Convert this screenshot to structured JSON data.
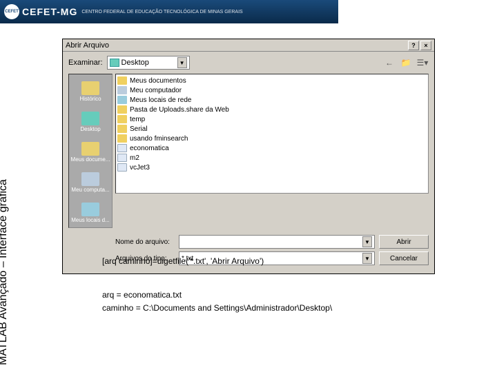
{
  "header": {
    "org": "CEFET-MG",
    "sub": "CENTRO FEDERAL DE EDUCAÇÃO TECNOLÓGICA DE MINAS GERAIS"
  },
  "sidebar_label": "MATLAB  Avançado – Interface gráfica",
  "dialog": {
    "title": "Abrir Arquivo",
    "help": "?",
    "close": "×",
    "lookin_label": "Examinar:",
    "lookin_value": "Desktop",
    "back_icon": "←",
    "up_icon": "📁",
    "view_icon": "☰▾",
    "places": [
      {
        "label": "Histórico"
      },
      {
        "label": "Desktop"
      },
      {
        "label": "Meus docume..."
      },
      {
        "label": "Meu computa..."
      },
      {
        "label": "Meus locais d..."
      }
    ],
    "files": [
      {
        "icon": "folder",
        "name": "Meus documentos"
      },
      {
        "icon": "pc",
        "name": "Meu computador"
      },
      {
        "icon": "net",
        "name": "Meus locais de rede"
      },
      {
        "icon": "folder",
        "name": "Pasta de Uploads.share da Web"
      },
      {
        "icon": "folder",
        "name": "temp"
      },
      {
        "icon": "folder",
        "name": "Serial"
      },
      {
        "icon": "folder",
        "name": "usando fminsearch"
      },
      {
        "icon": "doc",
        "name": "economatica"
      },
      {
        "icon": "doc",
        "name": "m2"
      },
      {
        "icon": "doc",
        "name": "vcJet3"
      }
    ],
    "filename_label": "Nome do arquivo:",
    "filename_value": "",
    "filetype_label": "Arquivos do tipo:",
    "filetype_value": "*.txt",
    "open_btn": "Abrir",
    "cancel_btn": "Cancelar"
  },
  "output": {
    "line1": "[arq caminho]=uigetfile('*.txt', 'Abrir Arquivo')",
    "line2": "arq = economatica.txt",
    "line3": "caminho = C:\\Documents and Settings\\Administrador\\Desktop\\"
  }
}
